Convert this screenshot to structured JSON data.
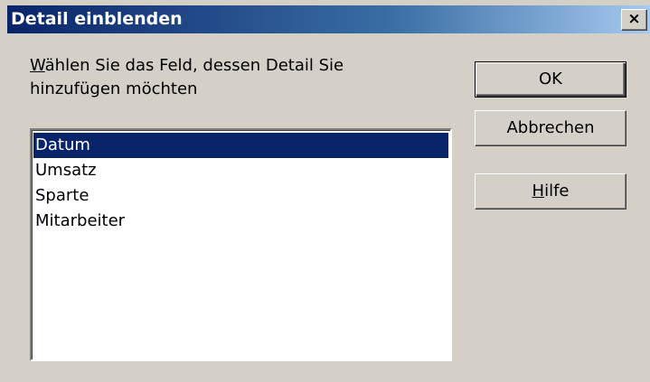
{
  "window": {
    "title": "Detail einblenden",
    "close_glyph": "×"
  },
  "prompt": {
    "mnemonic": "W",
    "line1_rest": "ählen Sie das Feld, dessen Detail Sie",
    "line2": "hinzufügen möchten"
  },
  "list": {
    "items": [
      "Datum",
      "Umsatz",
      "Sparte",
      "Mitarbeiter"
    ],
    "selected_index": 0
  },
  "buttons": {
    "ok_label": "OK",
    "cancel_label": "Abbrechen",
    "help_mnemonic": "H",
    "help_rest": "ilfe"
  },
  "colors": {
    "dialog_face": "#d4d0c8",
    "title_start": "#0a246a",
    "title_end": "#a6caf0",
    "selection": "#0a246a"
  }
}
